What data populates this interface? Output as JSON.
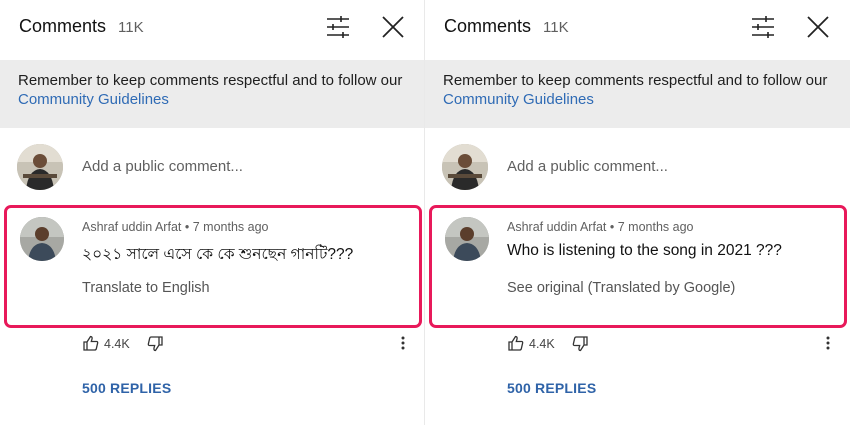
{
  "left_panel": {
    "header": {
      "title": "Comments",
      "count": "11K"
    },
    "notice": {
      "text": "Remember to keep comments respectful and to follow our ",
      "link": "Community Guidelines"
    },
    "add_comment": {
      "placeholder": "Add a public comment..."
    },
    "comment": {
      "author": "Ashraf uddin Arfat",
      "separator": "•",
      "time": "7 months ago",
      "text": "২০২১ সালে এসে কে কে শুনছেন গানটি???",
      "translate_action": "Translate to English",
      "likes": "4.4K",
      "replies": "500 REPLIES"
    }
  },
  "right_panel": {
    "header": {
      "title": "Comments",
      "count": "11K"
    },
    "notice": {
      "text": "Remember to keep comments respectful and to follow our ",
      "link": "Community Guidelines"
    },
    "add_comment": {
      "placeholder": "Add a public comment..."
    },
    "comment": {
      "author": "Ashraf uddin Arfat",
      "separator": "•",
      "time": "7 months ago",
      "text": "Who is listening to the song in 2021 ???",
      "translate_action": "See original (Translated by Google)",
      "likes": "4.4K",
      "replies": "500 REPLIES"
    }
  },
  "colors": {
    "highlight": "#e8195a",
    "link": "#2f6bb5",
    "replies": "#2f63a8",
    "notice_bg": "#ececec"
  },
  "icons": [
    "sliders-icon",
    "close-icon",
    "thumbs-up-icon",
    "thumbs-down-icon",
    "more-vert-icon"
  ]
}
